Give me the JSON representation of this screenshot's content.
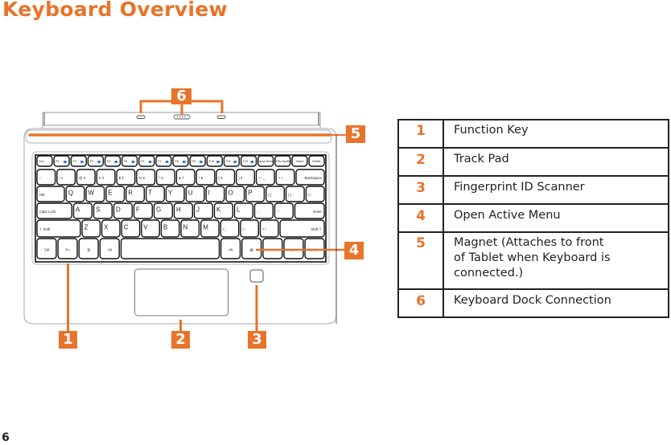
{
  "page": {
    "title": "Keyboard Overview",
    "page_number": "6",
    "accent_color": "#E8732A"
  },
  "diagram": {
    "callouts": [
      {
        "number": "1",
        "target": "Fn key"
      },
      {
        "number": "2",
        "target": "Track pad"
      },
      {
        "number": "3",
        "target": "Fingerprint ID scanner"
      },
      {
        "number": "4",
        "target": "Menu key"
      },
      {
        "number": "5",
        "target": "Magnet strip"
      },
      {
        "number": "6",
        "target": "Dock connectors"
      }
    ],
    "keyboard": {
      "rows": [
        [
          "Esc",
          "F1",
          "F2",
          "F3",
          "F4",
          "F5",
          "F6",
          "F7",
          "F8",
          "F9",
          "F10",
          "F11",
          "F12",
          "Pause Break",
          "PrtSc SysRq",
          "Insert",
          "Delete"
        ],
        [
          "~ `",
          "! 1",
          "@ 2",
          "# 3",
          "$ 4",
          "% 5",
          "^ 6",
          "& 7",
          "* 8",
          "( 9",
          ") 0",
          "— _",
          "+ =",
          "Backspace"
        ],
        [
          "Tab",
          "Q",
          "W",
          "E",
          "R",
          "T",
          "Y",
          "U",
          "I",
          "O",
          "P",
          "{ [",
          "} ]",
          "| \\"
        ],
        [
          "Caps Lock",
          "A",
          "S",
          "D",
          "F",
          "G",
          "H",
          "J",
          "K",
          "L",
          ": ;",
          "\" '",
          "Enter"
        ],
        [
          "⇧ Shift",
          "Z",
          "X",
          "C",
          "V",
          "B",
          "N",
          "M",
          "< ,",
          "> .",
          "? /",
          "Shift ⇧"
        ],
        [
          "Ctrl",
          "Fn",
          "⊞",
          "Alt",
          "",
          "Alt",
          "▤",
          "Home ◄",
          "▲ ▼",
          "End ►"
        ]
      ]
    }
  },
  "legend": {
    "items": [
      {
        "number": "1",
        "label": "Function Key"
      },
      {
        "number": "2",
        "label": "Track Pad"
      },
      {
        "number": "3",
        "label": "Fingerprint ID Scanner"
      },
      {
        "number": "4",
        "label": "Open Active Menu"
      },
      {
        "number": "5",
        "label_lines": [
          "Magnet (Attaches to front",
          "of Tablet when Keyboard is",
          "connected.)"
        ]
      },
      {
        "number": "6",
        "label": "Keyboard Dock Connection"
      }
    ]
  }
}
